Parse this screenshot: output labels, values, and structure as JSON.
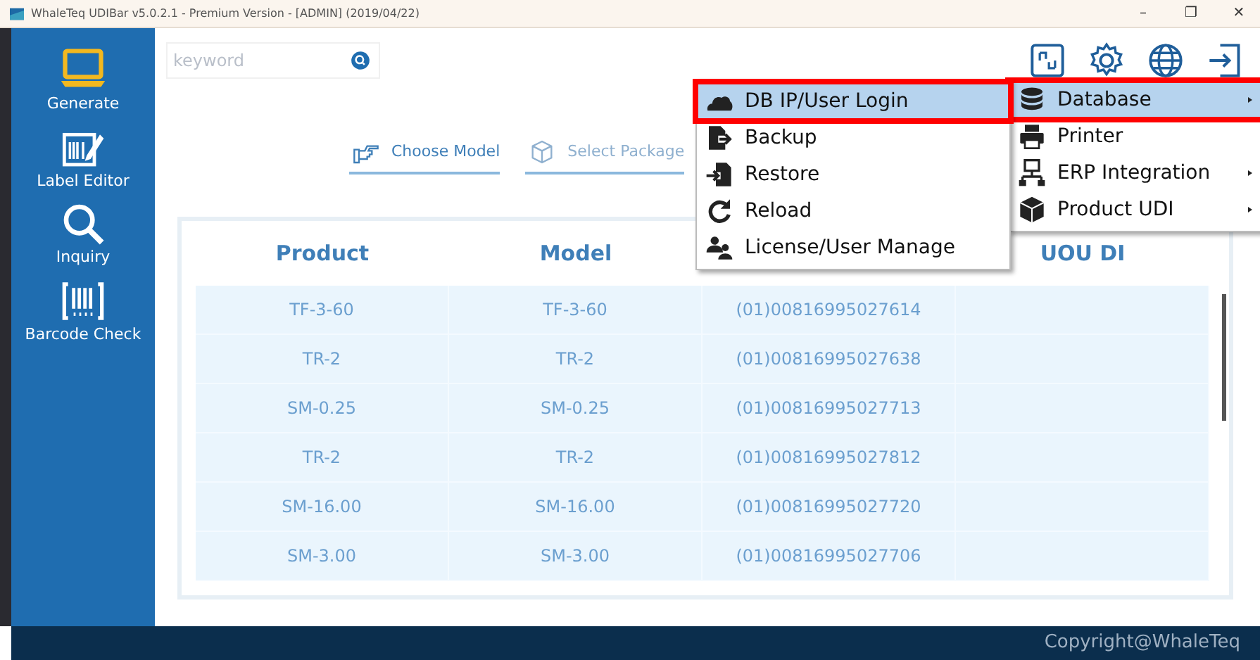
{
  "window": {
    "title": "WhaleTeq UDIBar v5.0.2.1 - Premium Version - [ADMIN] (2019/04/22)",
    "controls": [
      "–",
      "❐",
      "✕"
    ]
  },
  "sidebar": {
    "items": [
      {
        "label": "Generate",
        "kind": "laptop",
        "selected": true
      },
      {
        "label": "Label Editor",
        "kind": "editor",
        "selected": false
      },
      {
        "label": "Inquiry",
        "kind": "search",
        "selected": false
      },
      {
        "label": "Barcode Check",
        "kind": "barcode",
        "selected": false
      }
    ]
  },
  "search": {
    "placeholder": "keyword"
  },
  "toolbar": [
    {
      "kind": "device"
    },
    {
      "kind": "settings"
    },
    {
      "kind": "globe"
    },
    {
      "kind": "logout"
    }
  ],
  "steps": [
    {
      "label": "Choose Model",
      "kind": "hand",
      "selected": true
    },
    {
      "label": "Select Package",
      "kind": "box",
      "selected": false
    }
  ],
  "table": {
    "columns": [
      "Product",
      "Model",
      "",
      "UOU DI"
    ],
    "rows": [
      {
        "cells": [
          "TF-3-60",
          "TF-3-60",
          "(01)00816995027614"
        ]
      },
      {
        "cells": [
          "TR-2",
          "TR-2",
          "(01)00816995027638"
        ]
      },
      {
        "cells": [
          "SM-0.25",
          "SM-0.25",
          "(01)00816995027713"
        ]
      },
      {
        "cells": [
          "TR-2",
          "TR-2",
          "(01)00816995027812"
        ]
      },
      {
        "cells": [
          "SM-16.00",
          "SM-16.00",
          "(01)00816995027720"
        ]
      },
      {
        "cells": [
          "SM-3.00",
          "SM-3.00",
          "(01)00816995027706"
        ]
      }
    ]
  },
  "settings_menu": {
    "items": [
      {
        "label": "Database",
        "kind": "database",
        "submenu": true,
        "selected": true
      },
      {
        "label": "Printer",
        "kind": "printer",
        "submenu": false,
        "selected": false
      },
      {
        "label": "ERP Integration",
        "kind": "network",
        "submenu": true,
        "selected": false
      },
      {
        "label": "Product UDI",
        "kind": "cube",
        "submenu": true,
        "selected": false
      }
    ]
  },
  "database_menu": {
    "items": [
      {
        "label": "DB IP/User Login",
        "kind": "cloud",
        "selected": true
      },
      {
        "label": "Backup",
        "kind": "export",
        "selected": false
      },
      {
        "label": "Restore",
        "kind": "import",
        "selected": false
      },
      {
        "label": "Reload",
        "kind": "reload",
        "selected": false
      },
      {
        "label": "License/User Manage",
        "kind": "users",
        "selected": false
      }
    ]
  },
  "status_bar": {
    "text": "Copyright@WhaleTeq"
  }
}
